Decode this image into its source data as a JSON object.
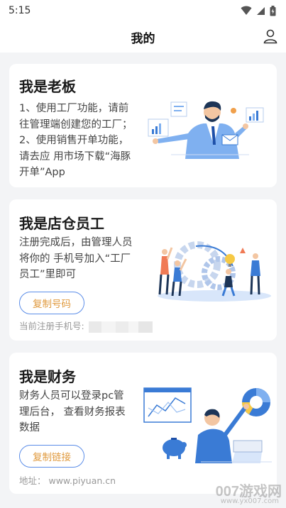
{
  "status": {
    "time": "5:15"
  },
  "header": {
    "title": "我的"
  },
  "cards": [
    {
      "title": "我是老板",
      "desc": "1、使用工厂功能，请前\n往管理端创建您的工厂；\n2、使用销售开单功能，\n请去应 用市场下载“海豚\n开单”App"
    },
    {
      "title": "我是店仓员工",
      "desc": "注册完成后，由管理人员\n将你的 手机号加入“工厂\n员工”里即可",
      "button": "复制号码",
      "phone_label": "当前注册手机号:"
    },
    {
      "title": "我是财务",
      "desc": "财务人员可以登录pc管\n理后台， 查看财务报表\n数据",
      "button": "复制链接",
      "address": "地址： www.piyuan.cn"
    }
  ],
  "watermark": {
    "text": "007游戏网",
    "url": "www.yx007.com"
  },
  "colors": {
    "accent_border": "#5b8de8",
    "button_text": "#e09a3e",
    "illustration_blue": "#3a7bd5"
  }
}
